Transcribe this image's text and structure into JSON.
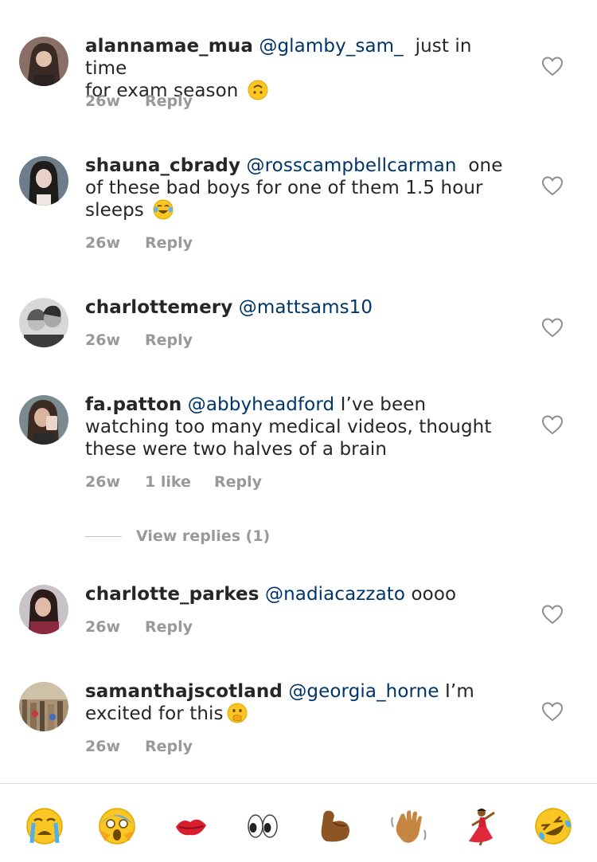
{
  "comments": [
    {
      "username": "alannamae_mua",
      "mention": "@glamby_sam_",
      "text_line1": "just in time",
      "text_line2": "for exam season",
      "emoji": "upside-down-face",
      "time": "26w",
      "reply": "Reply"
    },
    {
      "username": "shauna_cbrady",
      "mention": "@rosscampbellcarman",
      "text_line1": "one",
      "text_line2": "of these bad boys for one of them 1.5 hour",
      "text_line3": "sleeps",
      "emoji": "tears-of-joy-face",
      "time": "26w",
      "reply": "Reply"
    },
    {
      "username": "charlottemery",
      "mention": "@mattsams10",
      "time": "26w",
      "reply": "Reply"
    },
    {
      "username": "fa.patton",
      "mention": "@abbyheadford",
      "text_line1": "I’ve been",
      "text_line2": "watching too many medical videos, thought",
      "text_line3": "these were two halves of a brain",
      "time": "26w",
      "likes": "1 like",
      "reply": "Reply",
      "view_replies": "View replies (1)"
    },
    {
      "username": "charlotte_parkes",
      "mention": "@nadiacazzato",
      "text_line1": "oooo",
      "time": "26w",
      "reply": "Reply"
    },
    {
      "username": "samanthajscotland",
      "mention": "@georgia_horne",
      "text_line1": "I’m",
      "text_line2": "excited for this",
      "emoji": "hand-over-mouth-face",
      "time": "26w",
      "reply": "Reply"
    }
  ],
  "emoji_bar": [
    "loudly-crying-face",
    "screaming-in-fear-face",
    "kiss-mark",
    "eyes",
    "flexed-biceps",
    "waving-hand",
    "woman-dancing",
    "rolling-on-floor-laughing-face"
  ],
  "colors": {
    "text": "#262626",
    "mention": "#003569",
    "meta": "#999999",
    "heart": "#8e8e8e",
    "divider": "#dbdbdb"
  }
}
